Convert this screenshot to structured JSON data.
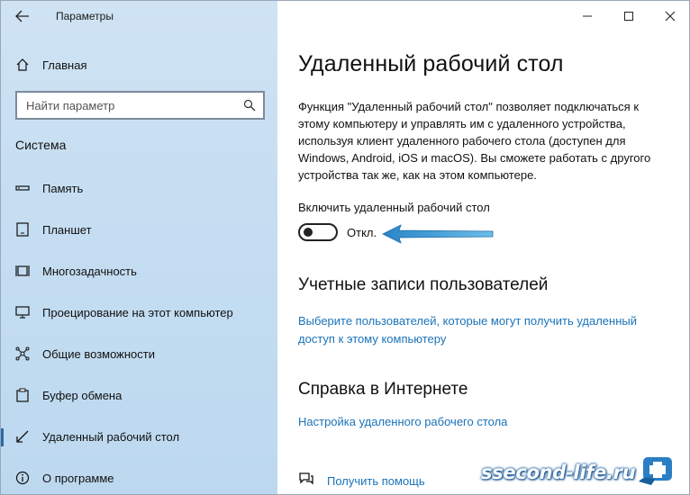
{
  "window": {
    "title": "Параметры"
  },
  "sidebar": {
    "home_label": "Главная",
    "search": {
      "placeholder": "Найти параметр"
    },
    "section_title": "Система",
    "items": [
      {
        "label": "Память",
        "icon": "storage-icon"
      },
      {
        "label": "Планшет",
        "icon": "tablet-icon"
      },
      {
        "label": "Многозадачность",
        "icon": "multitasking-icon"
      },
      {
        "label": "Проецирование на этот компьютер",
        "icon": "projecting-icon"
      },
      {
        "label": "Общие возможности",
        "icon": "shared-experiences-icon"
      },
      {
        "label": "Буфер обмена",
        "icon": "clipboard-icon"
      },
      {
        "label": "Удаленный рабочий стол",
        "icon": "remote-desktop-icon",
        "active": true
      },
      {
        "label": "О программе",
        "icon": "info-icon"
      }
    ]
  },
  "main": {
    "title": "Удаленный рабочий стол",
    "description": "Функция \"Удаленный рабочий стол\" позволяет подключаться к этому компьютеру и управлять им с удаленного устройства, используя клиент удаленного рабочего стола (доступен для Windows, Android, iOS и macOS). Вы сможете работать с другого устройства так же, как на этом компьютере.",
    "toggle": {
      "label": "Включить удаленный рабочий стол",
      "state": "Откл.",
      "on": false
    },
    "accounts": {
      "heading": "Учетные записи пользователей",
      "link": "Выберите пользователей, которые могут получить удаленный доступ к этому компьютеру"
    },
    "help": {
      "heading": "Справка в Интернете",
      "link": "Настройка удаленного рабочего стола"
    },
    "get_help": "Получить помощь"
  },
  "watermark": {
    "text": "ssecond-life.ru"
  },
  "colors": {
    "accent": "#1a73b9",
    "sidebar_bg": "#c6def2"
  }
}
